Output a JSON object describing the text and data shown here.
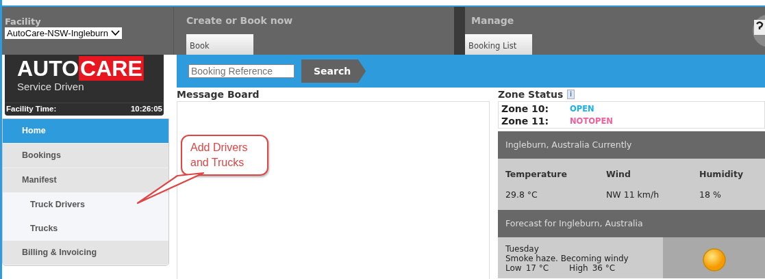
{
  "facility": {
    "label": "Facility",
    "value": "AutoCare-NSW-Ingleburn"
  },
  "logo": {
    "word_1": "AUTO",
    "word_2": "CARE",
    "tagline": "Service Driven"
  },
  "facility_time": {
    "label": "Facility Time:",
    "value": "10:26:05"
  },
  "menu_groups": [
    {
      "title": "Create or Book now",
      "buttons": [
        "Book"
      ]
    },
    {
      "title": "Manage",
      "buttons": [
        "Booking List"
      ]
    }
  ],
  "search": {
    "placeholder": "Booking Reference",
    "button": "Search"
  },
  "sidebar": {
    "items": [
      {
        "label": "Home",
        "selected": true
      },
      {
        "label": "Bookings",
        "selected": false
      },
      {
        "label": "Manifest",
        "selected": false,
        "children": [
          {
            "label": "Truck Drivers",
            "selected": false
          },
          {
            "label": "Trucks",
            "selected": false
          }
        ]
      },
      {
        "label": "Billing & Invoicing",
        "selected": false
      }
    ]
  },
  "message_board": {
    "title": "Message Board"
  },
  "callout": {
    "text": "Add Drivers and Trucks"
  },
  "zone_status": {
    "title": "Zone Status",
    "info": "i",
    "zones": [
      {
        "name": "Zone 10:",
        "status": "OPEN",
        "color": "#1ab0ec"
      },
      {
        "name": "Zone 11:",
        "status": "NOTOPEN",
        "color": "#f0609c"
      }
    ]
  },
  "current_weather": {
    "title": "Ingleburn, Australia Currently",
    "columns": [
      "Temperature",
      "Wind",
      "Humidity"
    ],
    "values": [
      "29.8 °C",
      "NW 11 km/h",
      "18 %"
    ]
  },
  "forecast": {
    "title": "Forecast for Ingleburn, Australia",
    "day": "Tuesday",
    "summary": "Smoke haze. Becoming windy",
    "low_label": "Low",
    "low": "17 °C",
    "high_label": "High",
    "high": "36 °C"
  }
}
